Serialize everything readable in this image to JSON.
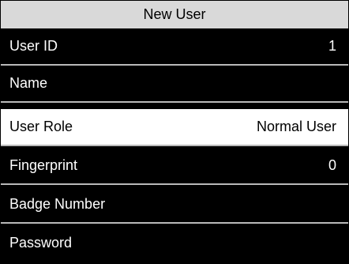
{
  "window": {
    "title": "New User"
  },
  "colors": {
    "title_background": "#d9d9d9",
    "menu_background": "#000000",
    "menu_text": "#ffffff",
    "selected_background": "#ffffff",
    "selected_text": "#000000",
    "divider": "#b9b9b9"
  },
  "menu": {
    "items": [
      {
        "label": "User ID",
        "value": "1"
      },
      {
        "label": "Name",
        "value": ""
      },
      {
        "label": "User Role",
        "value": "Normal User",
        "selected": true
      },
      {
        "label": "Fingerprint",
        "value": "0"
      },
      {
        "label": "Badge Number",
        "value": ""
      },
      {
        "label": "Password",
        "value": ""
      }
    ]
  }
}
